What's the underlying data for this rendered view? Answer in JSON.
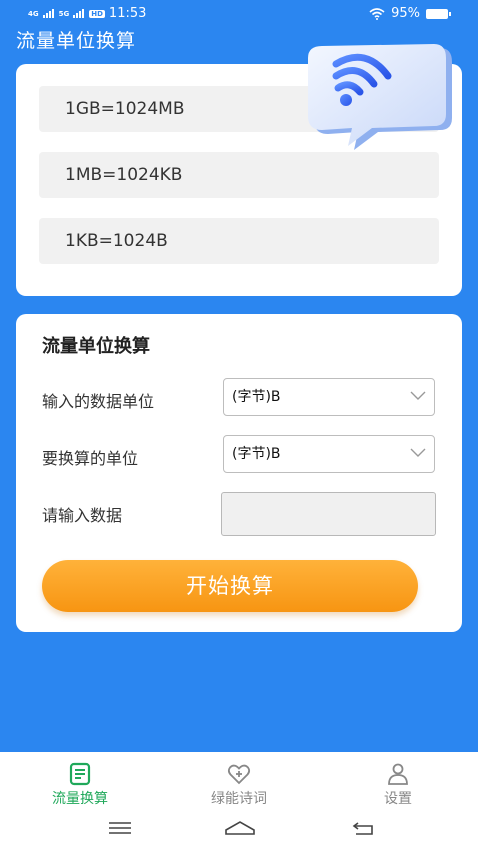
{
  "status": {
    "network1": "4G",
    "network2": "5G",
    "hd": "HD",
    "time": "11:53",
    "battery": "95%"
  },
  "app": {
    "title": "流量单位换算"
  },
  "reference": {
    "items": [
      "1GB=1024MB",
      "1MB=1024KB",
      "1KB=1024B"
    ]
  },
  "converter": {
    "title": "流量单位换算",
    "input_unit_label": "输入的数据单位",
    "input_unit_value": "(字节)B",
    "target_unit_label": "要换算的单位",
    "target_unit_value": "(字节)B",
    "data_label": "请输入数据",
    "data_value": "",
    "start_button": "开始换算"
  },
  "tabs": [
    {
      "label": "流量换算",
      "icon": "document-icon",
      "active": true
    },
    {
      "label": "绿能诗词",
      "icon": "heart-icon",
      "active": false
    },
    {
      "label": "设置",
      "icon": "person-icon",
      "active": false
    }
  ],
  "colors": {
    "background": "#2b86f0",
    "active_tab": "#1fa85a",
    "inactive_tab": "#888888",
    "button_orange": "#f79512"
  }
}
